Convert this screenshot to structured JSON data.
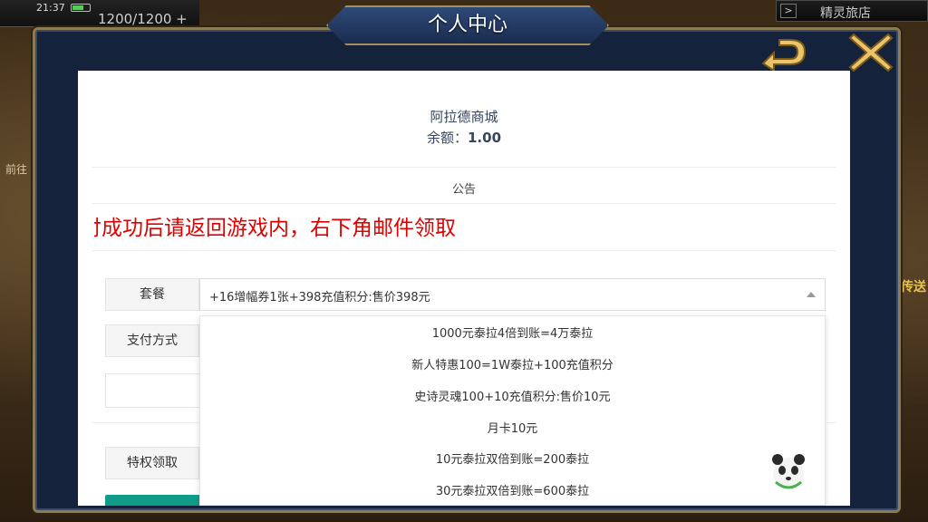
{
  "hud": {
    "time": "21:37",
    "hp": "1200/1200 +",
    "inn_arrow": ">",
    "inn_label": "精灵旅店",
    "left_side_label": "前往",
    "right_side_label": "传送"
  },
  "modal": {
    "title": "个人中心"
  },
  "shop": {
    "name": "阿拉德商城",
    "balance_label": "余额：",
    "balance_value": "1.00"
  },
  "notice": {
    "title": "公告",
    "marquee": "付成功后请返回游戏内，右下角邮件领取"
  },
  "form": {
    "package_label": "套餐",
    "package_selected": "+16增幅券1张+398充值积分:售价398元",
    "payment_label": "支付方式",
    "privilege_label": "特权领取"
  },
  "dropdown": {
    "options": [
      "1000元泰拉4倍到账=4万泰拉",
      "新人特惠100=1W泰拉+100充值积分",
      "史诗灵魂100+10充值积分:售价10元",
      "月卡10元",
      "10元泰拉双倍到账=200泰拉",
      "30元泰拉双倍到账=600泰拉"
    ]
  },
  "colors": {
    "accent": "#139b8a",
    "notice_red": "#e00000",
    "frame": "#14223b"
  }
}
